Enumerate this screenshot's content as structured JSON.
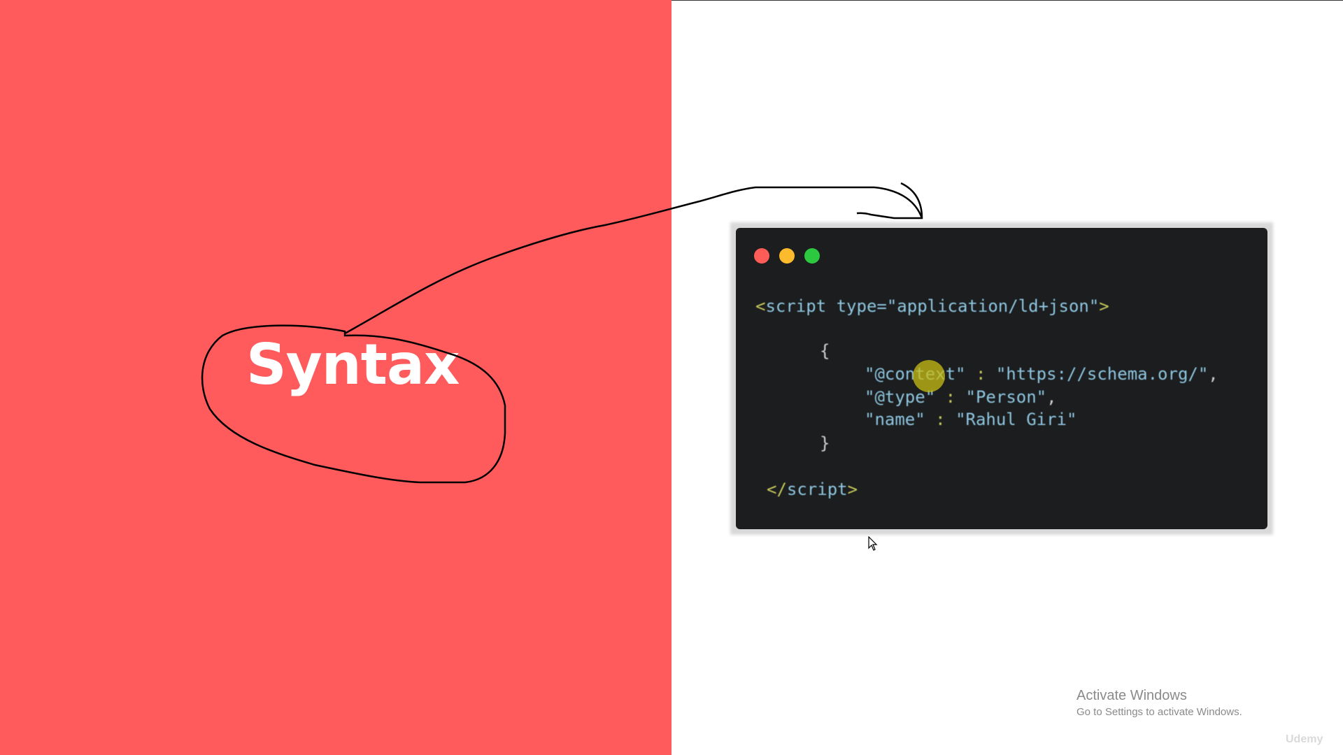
{
  "slide": {
    "title": "Syntax",
    "accent_color": "#ff5a5c"
  },
  "code_window": {
    "controls": [
      "close-dot",
      "minimize-dot",
      "maximize-dot"
    ],
    "lines": {
      "open_tag_start": "<",
      "open_tag_name": "script",
      "open_tag_attr": " type=",
      "open_tag_value": "\"application/ld+json\"",
      "open_tag_end": ">",
      "brace_open": "{",
      "context_key": "\"@context\"",
      "context_sep": " : ",
      "context_value": "\"https://schema.org/\"",
      "context_comma": ",",
      "type_key": "\"@type\"",
      "type_sep": " : ",
      "type_value": "\"Person\"",
      "type_comma": ",",
      "name_key": "\"name\"",
      "name_sep": " : ",
      "name_value": "\"Rahul Giri\"",
      "brace_close": "}",
      "close_tag_start": "</",
      "close_tag_name": "script",
      "close_tag_end": ">"
    }
  },
  "system": {
    "activate_title": "Activate Windows",
    "activate_subtitle": "Go to Settings to activate Windows.",
    "watermark": "Udemy"
  }
}
